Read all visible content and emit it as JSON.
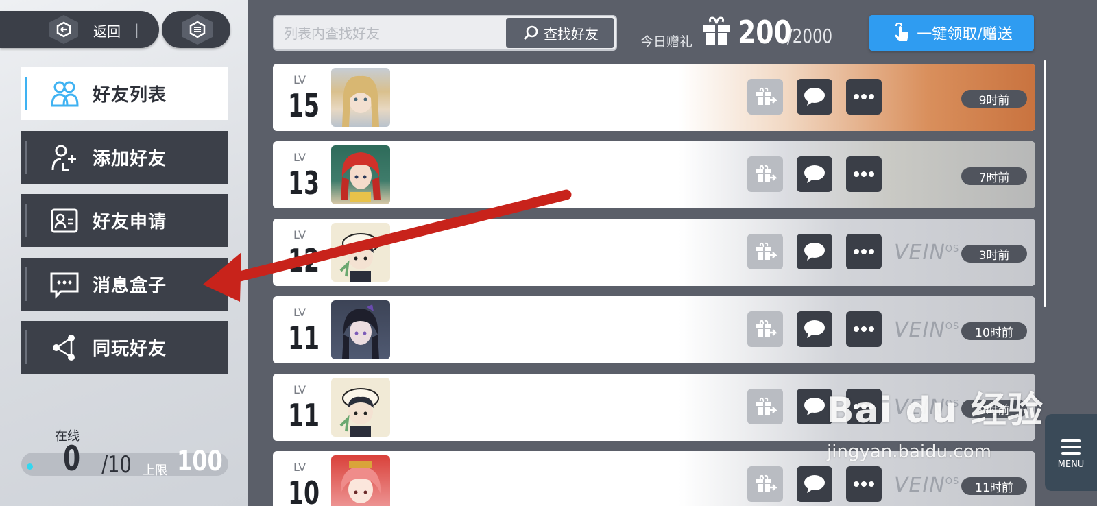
{
  "topbar": {
    "back_label": "返回",
    "back_separator": "|"
  },
  "menu": {
    "items": [
      {
        "label": "好友列表",
        "icon": "friends-icon"
      },
      {
        "label": "添加好友",
        "icon": "add-friend-icon"
      },
      {
        "label": "好友申请",
        "icon": "id-card-icon"
      },
      {
        "label": "消息盒子",
        "icon": "message-box-icon"
      },
      {
        "label": "同玩好友",
        "icon": "share-nodes-icon"
      }
    ]
  },
  "online": {
    "label": "在线",
    "count": "0",
    "max": "/10",
    "limit_label": "上限",
    "limit_value": "100"
  },
  "search": {
    "placeholder": "列表内查找好友",
    "button_label": "查找好友"
  },
  "gifts": {
    "label": "今日赠礼",
    "count": "200",
    "total": "/2000"
  },
  "claim_button": "一键领取/赠送",
  "friends": [
    {
      "lv_label": "LV",
      "level": "15",
      "time": "9时前"
    },
    {
      "lv_label": "LV",
      "level": "13",
      "time": "7时前"
    },
    {
      "lv_label": "LV",
      "level": "12",
      "time": "3时前"
    },
    {
      "lv_label": "LV",
      "level": "11",
      "time": "10时前"
    },
    {
      "lv_label": "LV",
      "level": "11",
      "time": "9时前"
    },
    {
      "lv_label": "LV",
      "level": "10",
      "time": "11时前"
    }
  ],
  "veinos_text": "VEIN",
  "veinos_sup": "OS",
  "menu_button_label": "MENU",
  "watermark": {
    "main": "Bai du 经验",
    "sub": "jingyan.baidu.com"
  },
  "colors": {
    "accent_blue": "#2f9cf1",
    "active_indicator": "#3fb2f2",
    "dark_panel": "#3c4049",
    "arrow_red": "#c8231b"
  }
}
